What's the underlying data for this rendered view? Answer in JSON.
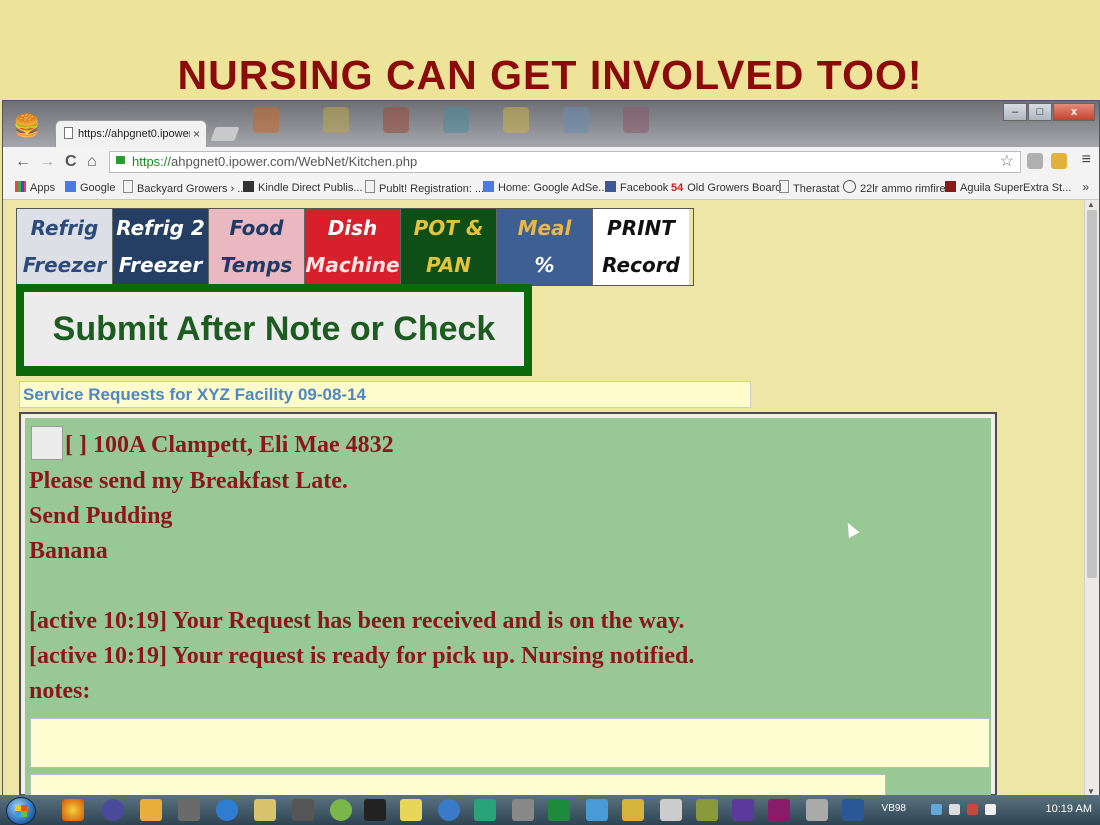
{
  "slide": {
    "title": "NURSING CAN GET INVOLVED TOO!"
  },
  "browser": {
    "tab_title": "https://ahpgnet0.ipower.c",
    "tab_close": "×",
    "url_secure": "https://",
    "url_rest": "ahpgnet0.ipower.com/WebNet/Kitchen.php",
    "nav": {
      "back": "←",
      "forward": "→",
      "reload": "C",
      "home": "⌂",
      "star": "☆",
      "menu": "≡"
    },
    "bookmarks": [
      "Apps",
      "Google",
      "Backyard Growers › ...",
      "Kindle Direct Publis...",
      "Publt! Registration: ...",
      "Home: Google AdSe...",
      "Facebook",
      "Old Growers Board",
      "Therastat",
      "22lr ammo rimfire",
      "Aguila SuperExtra St..."
    ],
    "bookmarks_more": "»",
    "bookmark_badge": "54"
  },
  "nav_buttons": [
    {
      "line1": "Refrig",
      "line2": "Freezer",
      "bg": "#dcdfe6",
      "color1": "#2c4a7a",
      "color2": "#2c4a7a"
    },
    {
      "line1": "Refrig 2",
      "line2": "Freezer",
      "bg": "#243e64",
      "color1": "#ffffff",
      "color2": "#ffffff"
    },
    {
      "line1": "Food",
      "line2": "Temps",
      "bg": "#eab8c0",
      "color1": "#1e3a66",
      "color2": "#1e3a66"
    },
    {
      "line1": "Dish",
      "line2": "Machine",
      "bg": "#d81f2c",
      "color1": "#ffffff",
      "color2": "#ffe4e4"
    },
    {
      "line1": "POT &",
      "line2": "PAN",
      "bg": "#0e4f18",
      "color1": "#e4c43c",
      "color2": "#e4c43c"
    },
    {
      "line1": "Meal",
      "line2": "%",
      "bg": "#3e5f92",
      "color1": "#e9b84a",
      "color2": "#ffffff"
    },
    {
      "line1": "PRINT",
      "line2": "Record",
      "bg": "#ffffff",
      "color1": "#111111",
      "color2": "#111111"
    }
  ],
  "submit_label": "Submit After Note or Check",
  "service_header": "Service Requests for XYZ Facility  09-08-14",
  "request": {
    "title": "[ ] 100A Clampett, Eli Mae 4832",
    "lines": [
      "Please send my Breakfast Late.",
      "Send Pudding",
      "Banana",
      "",
      "[active 10:19] Your Request has been received and is on the way.",
      "[active 10:19] Your request is ready for pick up. Nursing notified.",
      "notes:"
    ]
  },
  "taskbar": {
    "tray_label": "VB98",
    "clock": "10:19 AM"
  },
  "colors": {
    "title": "#8b0a0a",
    "request_text": "#8b1818",
    "panel_bg": "#98c995",
    "submit_border": "#0c6a0c",
    "header_text": "#4f86c6"
  }
}
